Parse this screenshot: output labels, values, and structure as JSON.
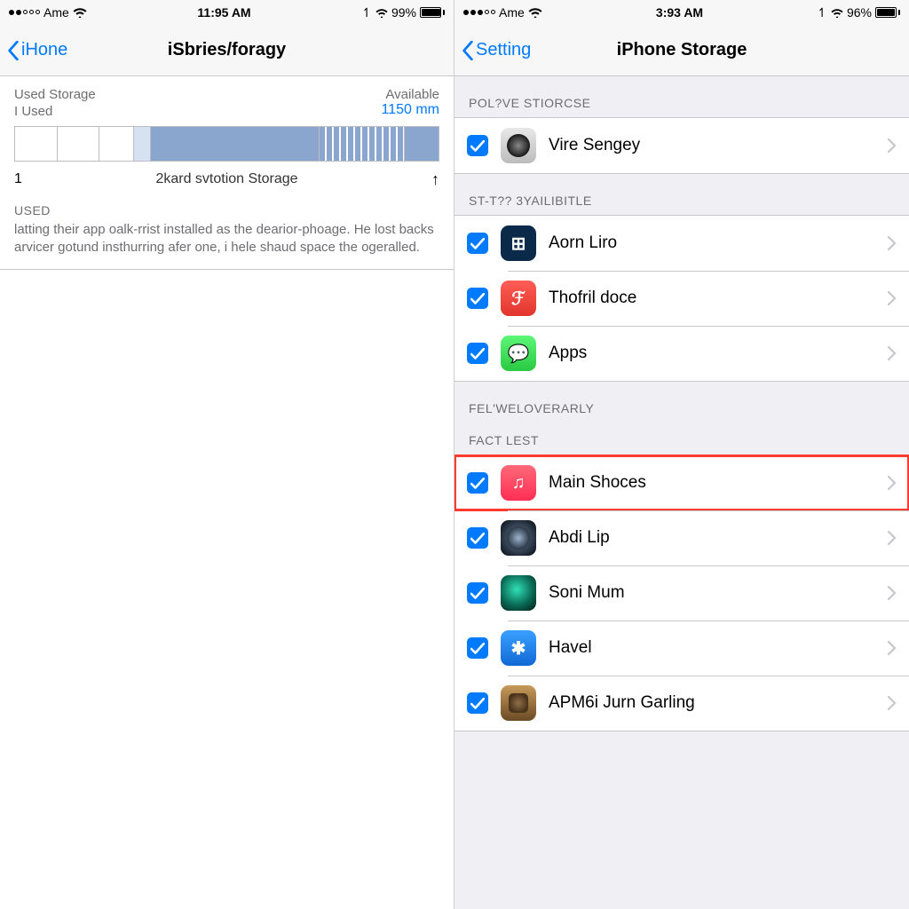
{
  "left": {
    "status": {
      "carrier": "Ame",
      "time": "11:95 AM",
      "battery_pct": "99%",
      "battery_fill": 96
    },
    "nav": {
      "back": "iHone",
      "title": "iSbries/foragy"
    },
    "storage": {
      "used_label": "Used Storage",
      "used_sub": "I Used",
      "available_label": "Available",
      "available_value": "1150 mm",
      "axis_start": "1",
      "caption": "2kard svtotion Storage",
      "used_header": "USED",
      "used_body": "latting their app oalk-rrist installed as the dearior-phoage. He lost backs arvicer gotund insthurring afer one, i hele shaud space the ogeralled."
    }
  },
  "right": {
    "status": {
      "carrier": "Ame",
      "time": "3:93 AM",
      "battery_pct": "96%",
      "battery_fill": 92
    },
    "nav": {
      "back": "Setting",
      "title": "iPhone Storage"
    },
    "sections": {
      "s1_header": "POL?VE STIORCSE",
      "s1_items": [
        {
          "label": "Vire Sengey",
          "icon": "ic-camera"
        }
      ],
      "s2_header": "ST-T?? 3YAILIBITLE",
      "s2_items": [
        {
          "label": "Aorn Liro",
          "icon": "ic-navy",
          "glyph": "⊞"
        },
        {
          "label": "Thofril doce",
          "icon": "ic-red",
          "glyph": "ℱ"
        },
        {
          "label": "Apps",
          "icon": "ic-green",
          "glyph": "💬"
        }
      ],
      "s3a_header": "FEL'WELOVERARLY",
      "s3b_header": "FACT LEST",
      "s3_items": [
        {
          "label": "Main Shoces",
          "icon": "ic-music",
          "glyph": "♫",
          "highlight": true
        },
        {
          "label": "Abdi Lip",
          "icon": "ic-lens"
        },
        {
          "label": "Soni Mum",
          "icon": "ic-globe"
        },
        {
          "label": "Havel",
          "icon": "ic-appstore",
          "glyph": "✱"
        },
        {
          "label": "APM6i Jurn Garling",
          "icon": "ic-brown"
        }
      ]
    }
  },
  "chart_data": {
    "type": "bar",
    "title": "Used Storage",
    "segments": [
      {
        "kind": "empty",
        "width": 10
      },
      {
        "kind": "empty",
        "width": 10
      },
      {
        "kind": "empty",
        "width": 8
      },
      {
        "kind": "light",
        "width": 4
      },
      {
        "kind": "fill",
        "width": 40
      },
      {
        "kind": "stripe",
        "width": 20
      },
      {
        "kind": "fill",
        "width": 8
      }
    ],
    "xlabel": "",
    "ylabel": "",
    "axis_start": "1",
    "legend": [
      "Used",
      "Available"
    ]
  }
}
